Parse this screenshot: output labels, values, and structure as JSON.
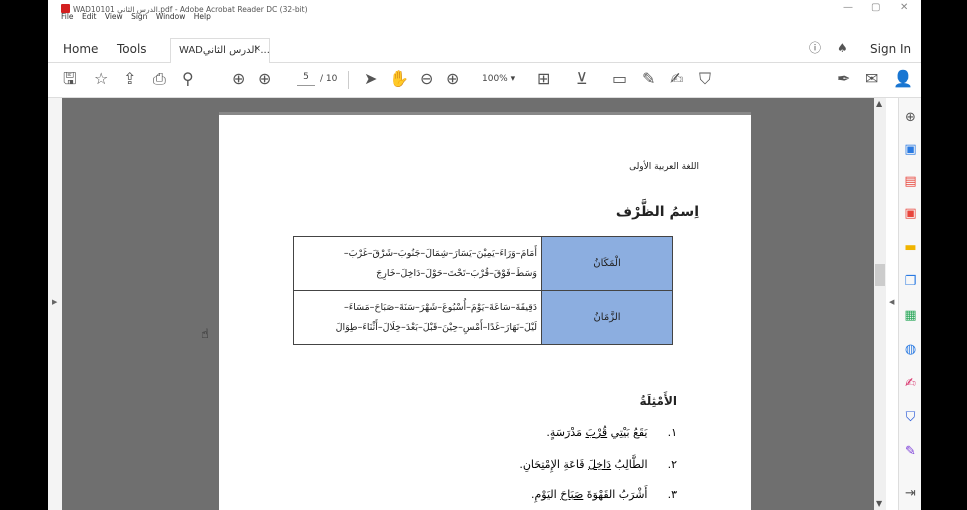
{
  "window": {
    "title": "WAD10101 الدرس الثاني.pdf - Adobe Acrobat Reader DC (32-bit)",
    "minimize": "—",
    "maximize": "▢",
    "close": "✕"
  },
  "menu": [
    "File",
    "Edit",
    "View",
    "Sign",
    "Window",
    "Help"
  ],
  "tabs": {
    "home": "Home",
    "tools": "Tools",
    "doc": "WADالدرس الثاني ...",
    "doc_close": "×",
    "sign_in": "Sign In"
  },
  "toolbar": {
    "page_current": "5",
    "page_total": "/ 10",
    "zoom": "100%"
  },
  "document": {
    "header": "اللغة العربية الأولى",
    "title": "اِسمُ الظَّرْف",
    "rows": [
      {
        "label": "الْمَكَانُ",
        "line1": "أَمَامَ–وَرَاءَ–يَمِيْنَ–يَسَارَ–شِمَالَ–جَنُوبَ–شَرْقَ–غَرْبَ–",
        "line2": "وَسَطَ–فَوْقَ–قُرْبَ–تَحْتَ–حَوْلَ–دَاخِلَ–خَارِجَ"
      },
      {
        "label": "الزَّمَانُ",
        "line1": "دَقِيقَةَ–سَاعَةَ–يَوْمَ–أُسْبُوعَ–شَهْرَ–سَنَةَ–صَبَاحَ–مَسَاءَ–",
        "line2": "لَيْلَ–نَهَارَ–غَدًا–أَمْسِ–حِيْنَ–قَبْلَ–بَعْدَ–خِلَالَ–أَثْنَاءَ–طِوَالَ"
      }
    ],
    "examples_heading": "الأَمْثِلَةُ",
    "examples": [
      {
        "num": "١.",
        "pre": "يَقَعُ بَيْتِي ",
        "under": "قُرْبَ",
        "post": " مَدْرَسَةٍ."
      },
      {
        "num": "٢.",
        "pre": "الطَّالِبُ ",
        "under": "دَاخِلَ",
        "post": " قَاعَةِ الإِمْتِحَانِ."
      },
      {
        "num": "٣.",
        "pre": "أَشْرَبُ القَهْوَةَ ",
        "under": "صَبَاحَ",
        "post": " اليَوْمِ."
      }
    ]
  },
  "colors": {
    "label_fill": "#8caee0",
    "viewer_bg": "#6f6f6f",
    "acrobat_red": "#d32020"
  }
}
